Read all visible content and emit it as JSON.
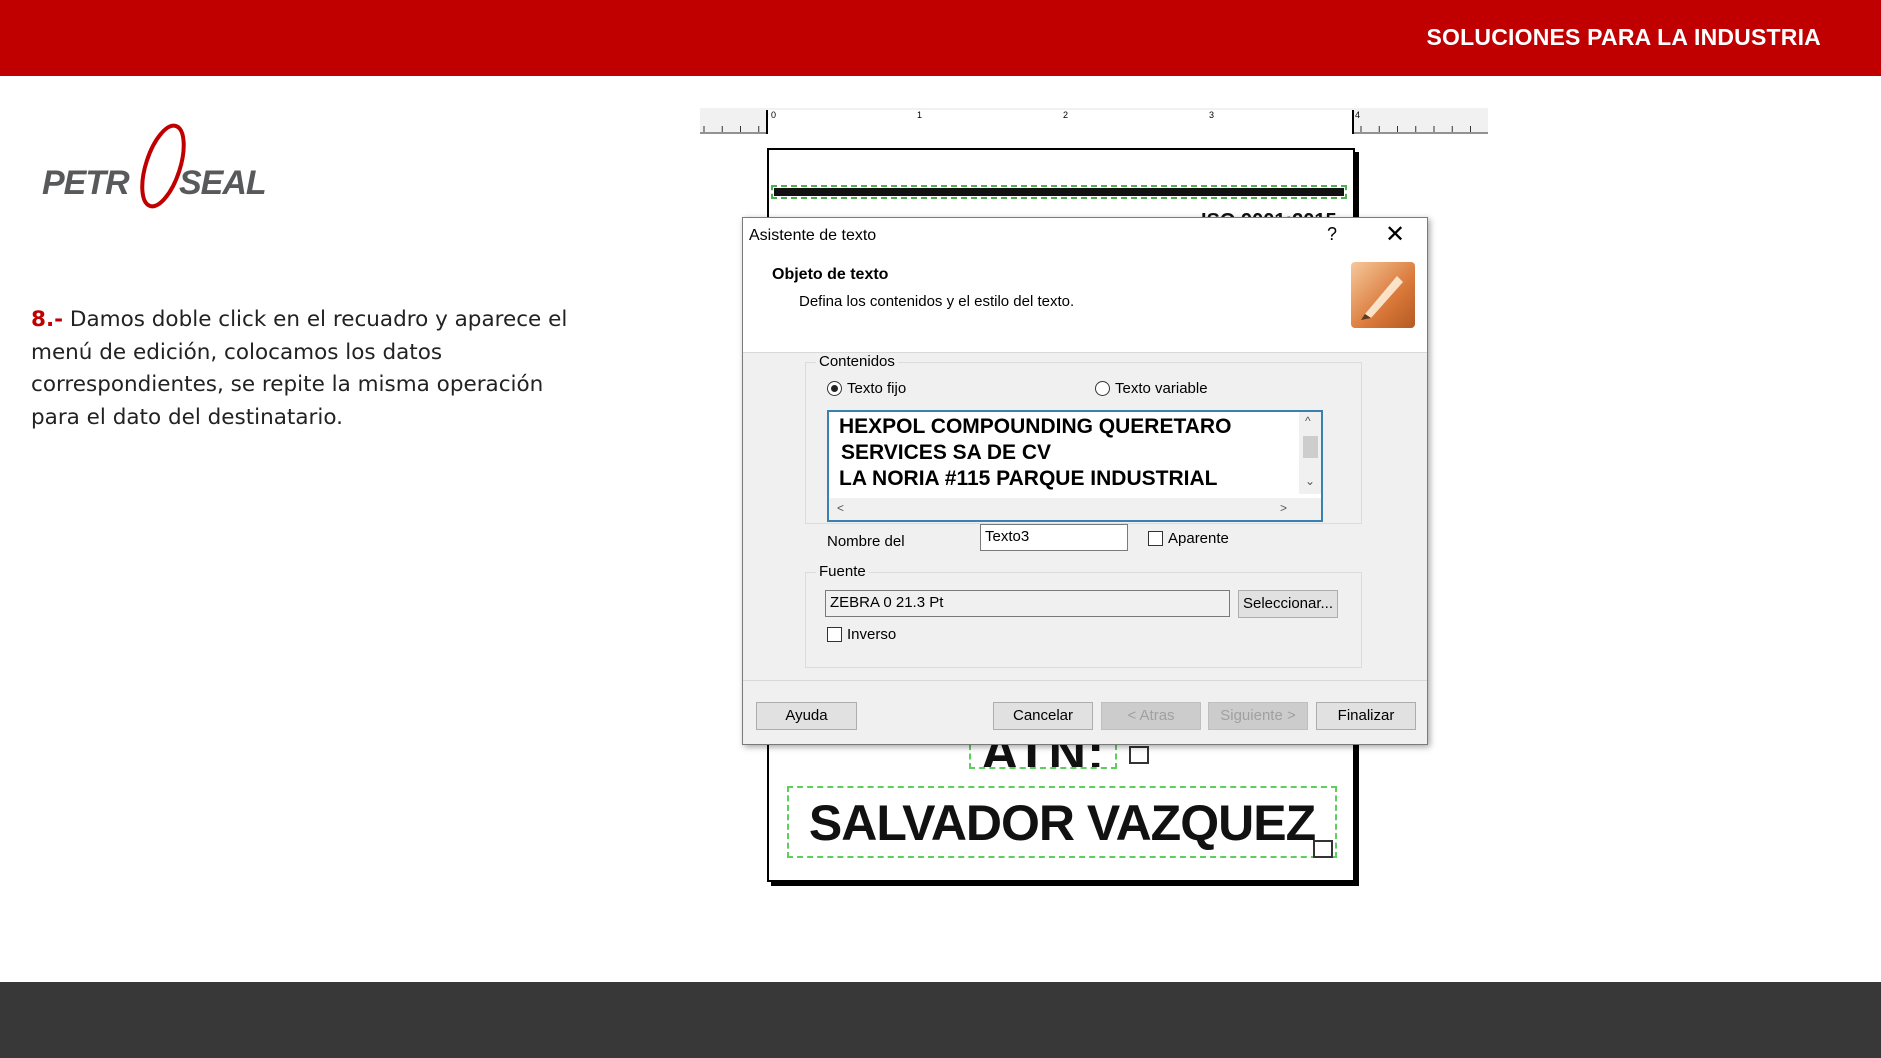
{
  "header": {
    "title": "SOLUCIONES PARA LA INDUSTRIA"
  },
  "logo": {
    "left_text": "PETR",
    "right_text": "SEAL"
  },
  "instruction": {
    "step": "8.-",
    "text": "Damos doble click en el recuadro y aparece el menú de edición, colocamos los datos correspondientes, se repite la misma operación para el dato del destinatario."
  },
  "label": {
    "ruler_marks": [
      "0",
      "1",
      "2",
      "3",
      "4"
    ],
    "iso": "ISO 9001:2015",
    "atn": "ATN:",
    "addressee": "SALVADOR VAZQUEZ"
  },
  "dialog": {
    "title": "Asistente de texto",
    "help_label": "?",
    "close_label": "✕",
    "heading": "Objeto de texto",
    "subheading": "Defina los contenidos y el estilo del texto.",
    "contents_group": "Contenidos",
    "radio_fixed": "Texto fijo",
    "radio_variable": "Texto variable",
    "text_lines": [
      "HEXPOL COMPOUNDING QUERETARO",
      "SERVICES SA DE CV",
      "LA NORIA #115 PARQUE INDUSTRIAL"
    ],
    "name_label": "Nombre del",
    "name_value": "Texto3",
    "visible_label": "Aparente",
    "font_group": "Fuente",
    "font_value": "ZEBRA 0 21.3 Pt",
    "select_button": "Seleccionar...",
    "inverse_label": "Inverso",
    "buttons": {
      "help": "Ayuda",
      "cancel": "Cancelar",
      "back": "< Atras",
      "next": "Siguiente >",
      "finish": "Finalizar"
    }
  },
  "colors": {
    "brand_red": "#c00000",
    "footer_gray": "#383838",
    "logo_gray": "#58595b"
  }
}
